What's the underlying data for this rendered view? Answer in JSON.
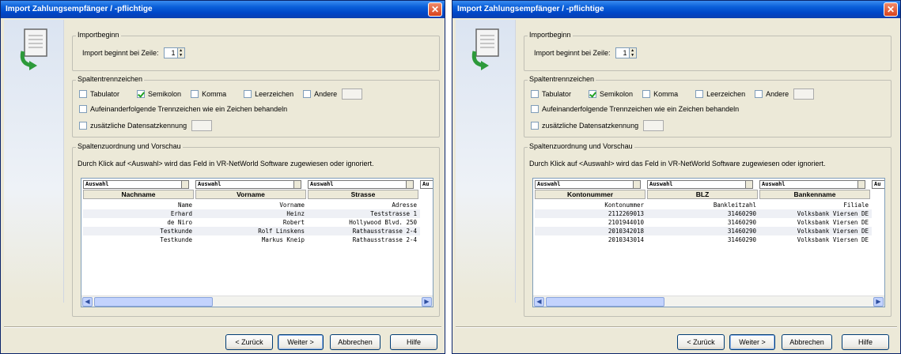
{
  "windows": [
    {
      "title": "Import Zahlungsempfänger / -pflichtige",
      "importbeginn": {
        "title": "Importbeginn",
        "label": "Import beginnt bei Zeile:",
        "value": "1"
      },
      "spaltentrenner": {
        "title": "Spaltentrennzeichen",
        "options": [
          {
            "label": "Tabulator",
            "checked": false
          },
          {
            "label": "Semikolon",
            "checked": true
          },
          {
            "label": "Komma",
            "checked": false
          },
          {
            "label": "Leerzeichen",
            "checked": false
          },
          {
            "label": "Andere",
            "checked": false
          }
        ],
        "merge_label": "Aufeinanderfolgende Trennzeichen wie ein Zeichen behandeln",
        "extra_label": "zusätzliche Datensatzkennung"
      },
      "vorschau": {
        "title": "Spaltenzuordnung und Vorschau",
        "hint": "Durch Klick auf <Auswahl> wird das Feld in VR-NetWorld Software zugewiesen oder ignoriert.",
        "auswahl": [
          "Auswahl",
          "Auswahl",
          "Auswahl",
          "Au"
        ],
        "columns": [
          "Nachname",
          "Vorname",
          "Strasse"
        ],
        "rows": [
          [
            "Name",
            "Vorname",
            "Adresse"
          ],
          [
            "Erhard",
            "Heinz",
            "Teststrasse 1"
          ],
          [
            "de Niro",
            "Robert",
            "Hollywood Blvd. 250"
          ],
          [
            "Testkunde",
            "Rolf Linskens",
            "Rathausstrasse 2-4"
          ],
          [
            "Testkunde",
            "Markus Kneip",
            "Rathausstrasse  2-4"
          ]
        ]
      },
      "buttons": {
        "back": "< Zurück",
        "next": "Weiter >",
        "cancel": "Abbrechen",
        "help": "Hilfe"
      }
    },
    {
      "title": "Import Zahlungsempfänger / -pflichtige",
      "importbeginn": {
        "title": "Importbeginn",
        "label": "Import beginnt bei Zeile:",
        "value": "1"
      },
      "spaltentrenner": {
        "title": "Spaltentrennzeichen",
        "options": [
          {
            "label": "Tabulator",
            "checked": false
          },
          {
            "label": "Semikolon",
            "checked": true
          },
          {
            "label": "Komma",
            "checked": false
          },
          {
            "label": "Leerzeichen",
            "checked": false
          },
          {
            "label": "Andere",
            "checked": false
          }
        ],
        "merge_label": "Aufeinanderfolgende Trennzeichen wie ein Zeichen behandeln",
        "extra_label": "zusätzliche Datensatzkennung"
      },
      "vorschau": {
        "title": "Spaltenzuordnung und Vorschau",
        "hint": "Durch Klick auf <Auswahl> wird das Feld in VR-NetWorld Software zugewiesen oder ignoriert.",
        "auswahl": [
          "Auswahl",
          "Auswahl",
          "Auswahl",
          "Au"
        ],
        "columns": [
          "Kontonummer",
          "BLZ",
          "Bankenname"
        ],
        "rows": [
          [
            "Kontonummer",
            "Bankleitzahl",
            "Filiale"
          ],
          [
            "2112269013",
            "31460290",
            "Volksbank Viersen DE"
          ],
          [
            "2101944010",
            "31460290",
            "Volksbank Viersen DE"
          ],
          [
            "2010342018",
            "31460290",
            "Volksbank Viersen DE"
          ],
          [
            "2010343014",
            "31460290",
            "Volksbank Viersen DE"
          ]
        ]
      },
      "buttons": {
        "back": "< Zurück",
        "next": "Weiter >",
        "cancel": "Abbrechen",
        "help": "Hilfe"
      }
    }
  ],
  "colors": {
    "titlebar": "#0a5fd9",
    "dialog_bg": "#ece9d8",
    "close": "#d8431d"
  }
}
